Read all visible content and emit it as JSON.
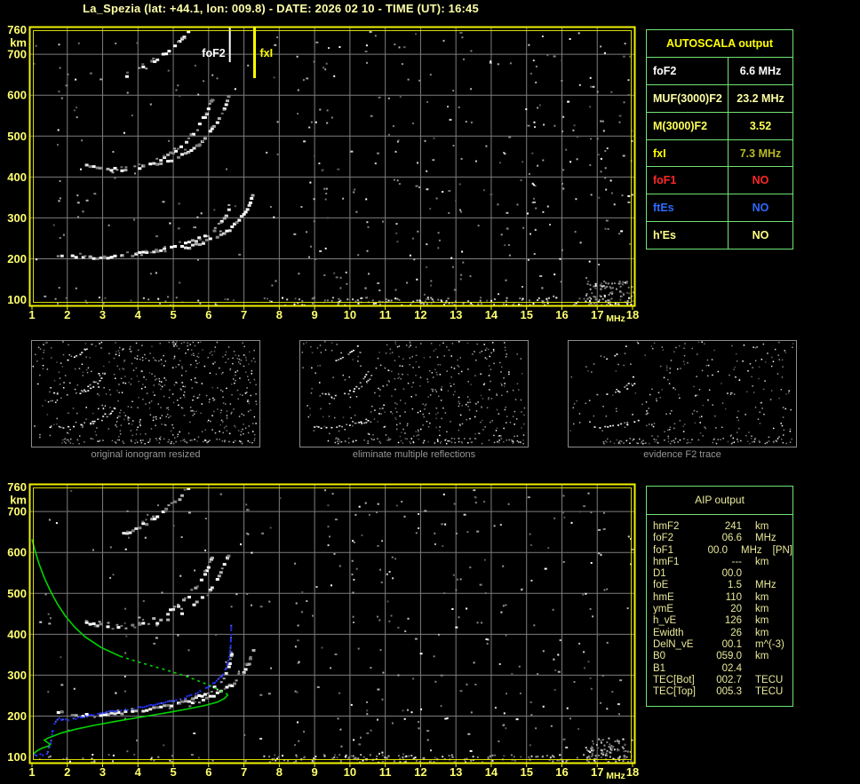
{
  "window": {
    "title": "La_Spezia (lat: +44.1, lon: 009.8) - DATE: 2026 02 10 - TIME (UT): 16:45"
  },
  "colors": {
    "background": "#000000",
    "title_yellow": "#ffffa8",
    "axis_label_yellow": "#ffff70",
    "plot_border_yellow": "#f2f200",
    "grid_gray": "#7d7d7d",
    "table_border_green": "#72e472",
    "profile_green": "#00d400",
    "restored_trace_blue": "#2633ff",
    "fof2_marker_white": "#ffffff",
    "fxi_marker_yellow": "#ffff00",
    "caption_gray": "#969696"
  },
  "autoscala_table": {
    "title": "AUTOSCALA output",
    "rows": [
      {
        "label": "foF2",
        "value": "6.6 MHz",
        "color": "#ffffff"
      },
      {
        "label": "MUF(3000)F2",
        "value": "23.2 MHz",
        "color": "#ffffa4"
      },
      {
        "label": "M(3000)F2",
        "value": "3.52",
        "color": "#ffff58"
      },
      {
        "label": "fxI",
        "value": "7.3 MHz",
        "color": "#ffff00",
        "value_color": "#b9b928"
      },
      {
        "label": "foF1",
        "value": "NO",
        "color": "#ff2828"
      },
      {
        "label": "ftEs",
        "value": "NO",
        "color": "#2e6bff"
      },
      {
        "label": "h'Es",
        "value": "NO",
        "color": "#ffff86"
      }
    ]
  },
  "aip_table": {
    "title": "AIP output",
    "rows": [
      {
        "label": "hmF2",
        "value": "241",
        "unit": "km",
        "note": ""
      },
      {
        "label": "foF2",
        "value": "06.6",
        "unit": "MHz",
        "note": ""
      },
      {
        "label": "foF1",
        "value": "00.0",
        "unit": "MHz",
        "note": "[PN]"
      },
      {
        "label": "hmF1",
        "value": "---",
        "unit": "km",
        "note": ""
      },
      {
        "label": "D1",
        "value": "00.0",
        "unit": "",
        "note": ""
      },
      {
        "label": "foE",
        "value": "1.5",
        "unit": "MHz",
        "note": ""
      },
      {
        "label": "hmE",
        "value": "110",
        "unit": "km",
        "note": ""
      },
      {
        "label": "ymE",
        "value": "20",
        "unit": "km",
        "note": ""
      },
      {
        "label": "h_vE",
        "value": "126",
        "unit": "km",
        "note": ""
      },
      {
        "label": "Ewidth",
        "value": "26",
        "unit": "km",
        "note": ""
      },
      {
        "label": "DelN_vE",
        "value": "00.1",
        "unit": "m^(-3)",
        "note": ""
      },
      {
        "label": "B0",
        "value": "059.0",
        "unit": "km",
        "note": ""
      },
      {
        "label": "B1",
        "value": "02.4",
        "unit": "",
        "note": ""
      },
      {
        "label": "TEC[Bot]",
        "value": "002.7",
        "unit": "TECU",
        "note": ""
      },
      {
        "label": "TEC[Top]",
        "value": "005.3",
        "unit": "TECU",
        "note": ""
      }
    ]
  },
  "thumbnails": [
    {
      "caption": "original ionogram resized"
    },
    {
      "caption": "eliminate multiple reflections"
    },
    {
      "caption": "evidence F2 trace"
    }
  ],
  "chart_data": {
    "type": "scatter",
    "title": "Ionogram - virtual height vs sounding frequency",
    "x_axis": {
      "label": "MHz",
      "min": 1,
      "max": 18,
      "ticks": [
        1,
        2,
        3,
        4,
        5,
        6,
        7,
        8,
        9,
        10,
        11,
        12,
        13,
        14,
        15,
        16,
        17,
        18
      ]
    },
    "y_axis": {
      "label": "km",
      "min": 100,
      "max": 760,
      "ticks": [
        760,
        700,
        600,
        500,
        400,
        300,
        200,
        100
      ]
    },
    "grid": true,
    "echo_traces": {
      "f2_ordinary": [
        [
          1.7,
          214
        ],
        [
          1.9,
          210
        ],
        [
          2.2,
          207
        ],
        [
          2.6,
          205
        ],
        [
          3.0,
          206
        ],
        [
          3.4,
          209
        ],
        [
          3.8,
          213
        ],
        [
          4.2,
          218
        ],
        [
          4.6,
          225
        ],
        [
          5.0,
          232
        ],
        [
          5.3,
          239
        ],
        [
          5.6,
          248
        ],
        [
          5.85,
          258
        ],
        [
          6.05,
          270
        ],
        [
          6.25,
          284
        ],
        [
          6.4,
          300
        ],
        [
          6.5,
          318
        ],
        [
          6.58,
          340
        ],
        [
          6.62,
          362
        ]
      ],
      "f2_extraordinary": [
        [
          5.3,
          230
        ],
        [
          5.7,
          239
        ],
        [
          6.0,
          249
        ],
        [
          6.3,
          261
        ],
        [
          6.55,
          275
        ],
        [
          6.75,
          291
        ],
        [
          6.95,
          312
        ],
        [
          7.1,
          333
        ],
        [
          7.2,
          355
        ],
        [
          7.25,
          375
        ]
      ],
      "second_reflection_a": [
        [
          2.5,
          431
        ],
        [
          3.0,
          423
        ],
        [
          3.5,
          420
        ],
        [
          4.0,
          427
        ],
        [
          4.4,
          439
        ],
        [
          4.8,
          455
        ],
        [
          5.1,
          473
        ],
        [
          5.4,
          497
        ],
        [
          5.65,
          524
        ],
        [
          5.85,
          552
        ],
        [
          6.0,
          578
        ],
        [
          6.08,
          600
        ]
      ],
      "second_reflection_b": [
        [
          4.5,
          432
        ],
        [
          4.9,
          444
        ],
        [
          5.3,
          461
        ],
        [
          5.7,
          485
        ],
        [
          6.0,
          512
        ],
        [
          6.25,
          545
        ],
        [
          6.45,
          580
        ],
        [
          6.55,
          605
        ]
      ],
      "third_reflection": [
        [
          3.55,
          648
        ],
        [
          3.9,
          661
        ],
        [
          4.2,
          675
        ],
        [
          4.5,
          691
        ],
        [
          4.75,
          707
        ],
        [
          5.0,
          724
        ],
        [
          5.2,
          741
        ],
        [
          5.38,
          757
        ],
        [
          5.45,
          764
        ]
      ]
    },
    "top_plot": {
      "markers": [
        {
          "name": "foF2",
          "freq_mhz": 6.6
        },
        {
          "name": "fxI",
          "freq_mhz": 7.3
        }
      ]
    },
    "bottom_plot": {
      "electron_density_profile_green": {
        "topside_solid": [
          [
            1.0,
            632
          ],
          [
            1.08,
            606
          ],
          [
            1.2,
            572
          ],
          [
            1.35,
            538
          ],
          [
            1.52,
            506
          ],
          [
            1.72,
            474
          ],
          [
            1.95,
            444
          ],
          [
            2.2,
            418
          ],
          [
            2.5,
            394
          ],
          [
            2.95,
            368
          ],
          [
            3.5,
            346
          ]
        ],
        "topside_dashed": [
          [
            3.5,
            346
          ],
          [
            4.1,
            330
          ],
          [
            4.7,
            315
          ],
          [
            5.3,
            299
          ],
          [
            5.8,
            283
          ],
          [
            6.15,
            270
          ],
          [
            6.4,
            259
          ],
          [
            6.55,
            252
          ]
        ],
        "bottomside_solid": [
          [
            6.55,
            252
          ],
          [
            6.45,
            243
          ],
          [
            6.25,
            234
          ],
          [
            5.9,
            226
          ],
          [
            5.45,
            218
          ],
          [
            4.95,
            210
          ],
          [
            4.4,
            202
          ],
          [
            3.85,
            194
          ],
          [
            3.3,
            186
          ],
          [
            2.75,
            177
          ],
          [
            2.25,
            168
          ],
          [
            1.85,
            159
          ],
          [
            1.6,
            151
          ],
          [
            1.45,
            146
          ],
          [
            1.35,
            141
          ],
          [
            1.42,
            136
          ],
          [
            1.52,
            131
          ],
          [
            1.45,
            126
          ],
          [
            1.3,
            122
          ],
          [
            1.18,
            117
          ],
          [
            1.1,
            112
          ],
          [
            1.05,
            108
          ]
        ]
      },
      "restored_trace_blue": [
        [
          1.05,
          106
        ],
        [
          1.15,
          107
        ],
        [
          1.28,
          108
        ],
        [
          1.4,
          111
        ],
        [
          1.5,
          132
        ],
        [
          1.58,
          178
        ],
        [
          1.65,
          190
        ],
        [
          1.75,
          196
        ],
        [
          1.85,
          193
        ],
        [
          2.0,
          192
        ],
        [
          2.15,
          195
        ],
        [
          2.35,
          199
        ],
        [
          2.6,
          203
        ],
        [
          2.9,
          208
        ],
        [
          3.2,
          212
        ],
        [
          3.5,
          216
        ],
        [
          3.8,
          220
        ],
        [
          4.1,
          224
        ],
        [
          4.4,
          229
        ],
        [
          4.7,
          234
        ],
        [
          5.0,
          240
        ],
        [
          5.3,
          247
        ],
        [
          5.55,
          255
        ],
        [
          5.8,
          264
        ],
        [
          6.0,
          274
        ],
        [
          6.2,
          287
        ],
        [
          6.35,
          300
        ],
        [
          6.45,
          315
        ],
        [
          6.52,
          332
        ],
        [
          6.57,
          352
        ],
        [
          6.6,
          375
        ],
        [
          6.61,
          400
        ],
        [
          6.62,
          438
        ]
      ]
    }
  }
}
